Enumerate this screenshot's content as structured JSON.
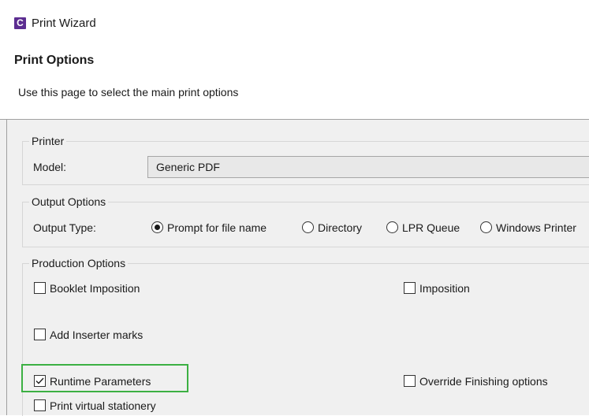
{
  "window": {
    "icon_letter": "C",
    "title": "Print Wizard"
  },
  "header": {
    "title": "Print Options",
    "description": "Use this page to select the main print options"
  },
  "printer": {
    "legend": "Printer",
    "model_label": "Model:",
    "model_value": "Generic PDF"
  },
  "output": {
    "legend": "Output Options",
    "type_label": "Output Type:",
    "options": [
      {
        "label": "Prompt for file name",
        "selected": true
      },
      {
        "label": "Directory",
        "selected": false
      },
      {
        "label": "LPR Queue",
        "selected": false
      },
      {
        "label": "Windows Printer",
        "selected": false
      }
    ]
  },
  "production": {
    "legend": "Production Options",
    "checkboxes": [
      {
        "label": "Booklet Imposition",
        "checked": false
      },
      {
        "label": "Imposition",
        "checked": false
      },
      {
        "label": "Add Inserter marks",
        "checked": false
      },
      {
        "label": "Runtime Parameters",
        "checked": true
      },
      {
        "label": "Override Finishing options",
        "checked": false
      },
      {
        "label": "Print virtual stationery",
        "checked": false
      }
    ]
  },
  "colors": {
    "app_icon": "#5c2d91",
    "highlight": "#3cb043",
    "content_bg": "#f0f0f0"
  }
}
